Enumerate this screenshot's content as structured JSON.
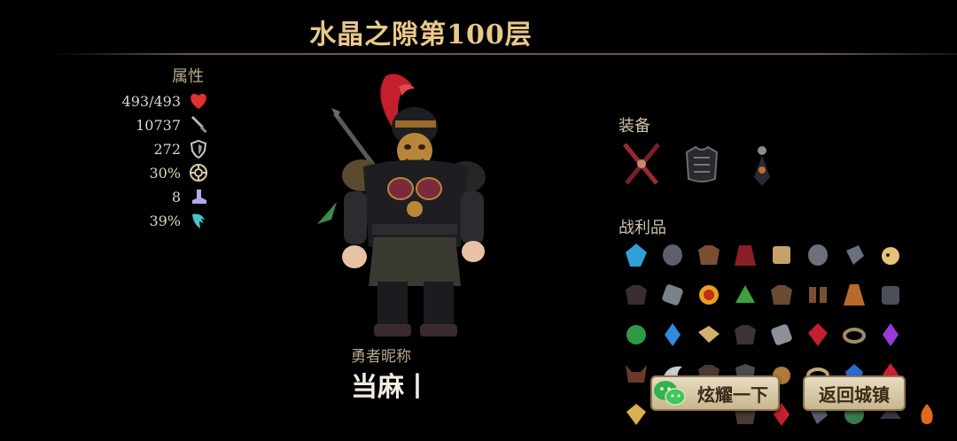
{
  "header": {
    "title": "水晶之隙第100层"
  },
  "stats": {
    "heading": "属性",
    "items": [
      {
        "value": "493/493",
        "icon": "heart-icon",
        "color": "#e03030"
      },
      {
        "value": "10737",
        "icon": "sword-icon",
        "color": "#b8b8b8"
      },
      {
        "value": "272",
        "icon": "shield-icon",
        "color": "#c8c8c8"
      },
      {
        "value": "30%",
        "icon": "crit-icon",
        "color": "#d8cfa8"
      },
      {
        "value": "8",
        "icon": "boot-icon",
        "color": "#b6a9e8"
      },
      {
        "value": "39%",
        "icon": "dodge-icon",
        "color": "#47c4c8"
      }
    ]
  },
  "hero": {
    "label": "勇者昵称",
    "name": "当麻丨"
  },
  "equipment": {
    "heading": "装备",
    "slots": [
      "crossed-swords-icon",
      "armor-icon",
      "amulet-icon"
    ]
  },
  "loot": {
    "heading": "战利品",
    "items": [
      "blue-crystal-icon",
      "helmet-icon",
      "leather-armor-icon",
      "red-cloak-icon",
      "scroll-icon",
      "helmet-icon",
      "gauntlet-icon",
      "cat-pet-icon",
      "leather-armor-icon",
      "stone-rune-icon",
      "fire-orb-icon",
      "green-plant-icon",
      "leather-armor-icon",
      "boots-icon",
      "robe-icon",
      "chest-armor-icon",
      "green-gem-icon",
      "blue-gem-icon",
      "scroll-icon",
      "dark-armor-icon",
      "stone-rune-icon",
      "red-gem-icon",
      "ring-icon",
      "purple-gem-icon",
      "horned-helm-icon",
      "wing-icon",
      "leather-armor-icon",
      "shield-icon",
      "cat-pet-icon",
      "ring-icon",
      "blue-orb-icon",
      "red-gem-icon",
      "gold-ring-icon",
      "",
      "",
      "",
      "",
      "",
      "",
      "fire-icon"
    ]
  },
  "buttons": {
    "share": "炫耀一下",
    "back": "返回城镇"
  },
  "colors": {
    "title": "#e9c98b",
    "accent": "#c8b68f"
  }
}
